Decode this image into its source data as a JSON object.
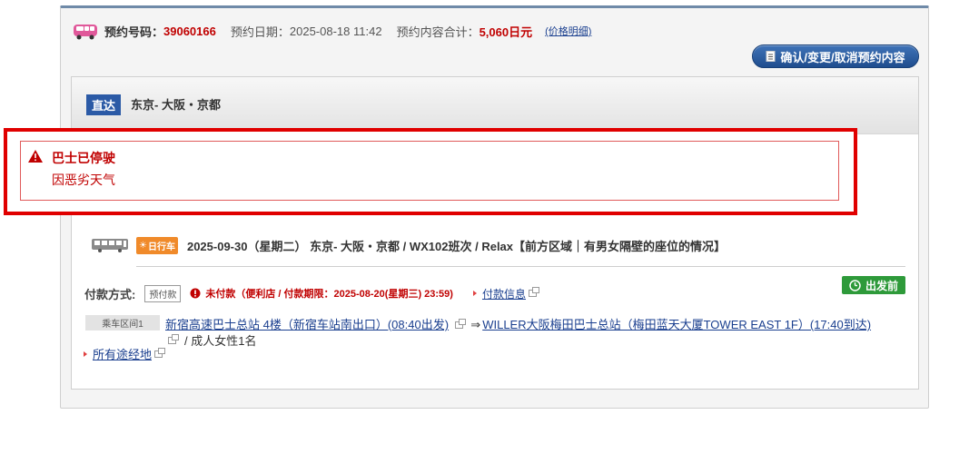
{
  "header": {
    "booking_no_label": "预约号码：",
    "booking_no": "39060166",
    "booking_date_label": "预约日期：",
    "booking_date": "2025-08-18 11:42",
    "total_label": "预约内容合计：",
    "total": "5,060日元",
    "price_detail": "(价格明细)",
    "confirm_button": "确认/变更/取消预约内容"
  },
  "route": {
    "tag": "直达",
    "title": "东京- 大阪・京都"
  },
  "alert": {
    "title": "巴士已停驶",
    "reason": "因恶劣天气"
  },
  "trip": {
    "day_tag": "日行车",
    "info": "2025-09-30（星期二） 东京- 大阪・京都 / WX102班次 / Relax【前方区域｜有男女隔壁的座位的情况】"
  },
  "payment": {
    "label": "付款方式:",
    "badge": "预付款",
    "warning": "未付款（便利店 / 付款期限：2025-08-20(星期三) 23:59)",
    "info_link": "付款信息",
    "status": "出发前"
  },
  "segment": {
    "tag": "乘车区间1",
    "from": "新宿高速巴士总站 4楼（新宿车站南出口）(08:40出发)",
    "arrow": "⇒",
    "to": "WILLER大阪梅田巴士总站（梅田蓝天大厦TOWER EAST 1F）(17:40到达)",
    "passengers": "/ 成人女性1名",
    "all_stops": "所有途经地"
  },
  "colors": {
    "accent_red": "#c00000",
    "link_blue": "#1a3f8f",
    "status_green": "#2e9a3a",
    "button_blue": "#2b5aa6"
  }
}
